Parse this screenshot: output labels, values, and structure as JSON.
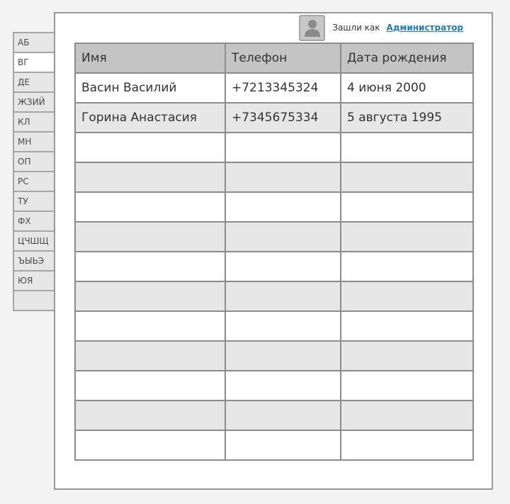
{
  "sidebar": {
    "tabs": [
      {
        "label": "АБ",
        "active": false
      },
      {
        "label": "ВГ",
        "active": true
      },
      {
        "label": "ДЕ",
        "active": false
      },
      {
        "label": "ЖЗИЙ",
        "active": false
      },
      {
        "label": "КЛ",
        "active": false
      },
      {
        "label": "МН",
        "active": false
      },
      {
        "label": "ОП",
        "active": false
      },
      {
        "label": "РС",
        "active": false
      },
      {
        "label": "ТУ",
        "active": false
      },
      {
        "label": "ФХ",
        "active": false
      },
      {
        "label": "ЦЧШЩ",
        "active": false
      },
      {
        "label": "ЪЫЬЭ",
        "active": false
      },
      {
        "label": "ЮЯ",
        "active": false
      }
    ]
  },
  "header": {
    "avatar_icon": "user-icon",
    "logged_in_label": "Зашли как",
    "user_link": "Администратор"
  },
  "table": {
    "columns": [
      "Имя",
      "Телефон",
      "Дата рождения"
    ],
    "rows": [
      [
        "Васин Василий",
        "+7213345324",
        "4 июня 2000"
      ],
      [
        "Горина Анастасия",
        "+7345675334",
        "5 августа 1995"
      ],
      [
        "",
        "",
        ""
      ],
      [
        "",
        "",
        ""
      ],
      [
        "",
        "",
        ""
      ],
      [
        "",
        "",
        ""
      ],
      [
        "",
        "",
        ""
      ],
      [
        "",
        "",
        ""
      ],
      [
        "",
        "",
        ""
      ],
      [
        "",
        "",
        ""
      ],
      [
        "",
        "",
        ""
      ],
      [
        "",
        "",
        ""
      ],
      [
        "",
        "",
        ""
      ]
    ]
  },
  "colors": {
    "link": "#1e7ac2",
    "header_row": "#c4c4c4",
    "alt_row": "#e6e6e6",
    "border": "#8c8c8c"
  }
}
